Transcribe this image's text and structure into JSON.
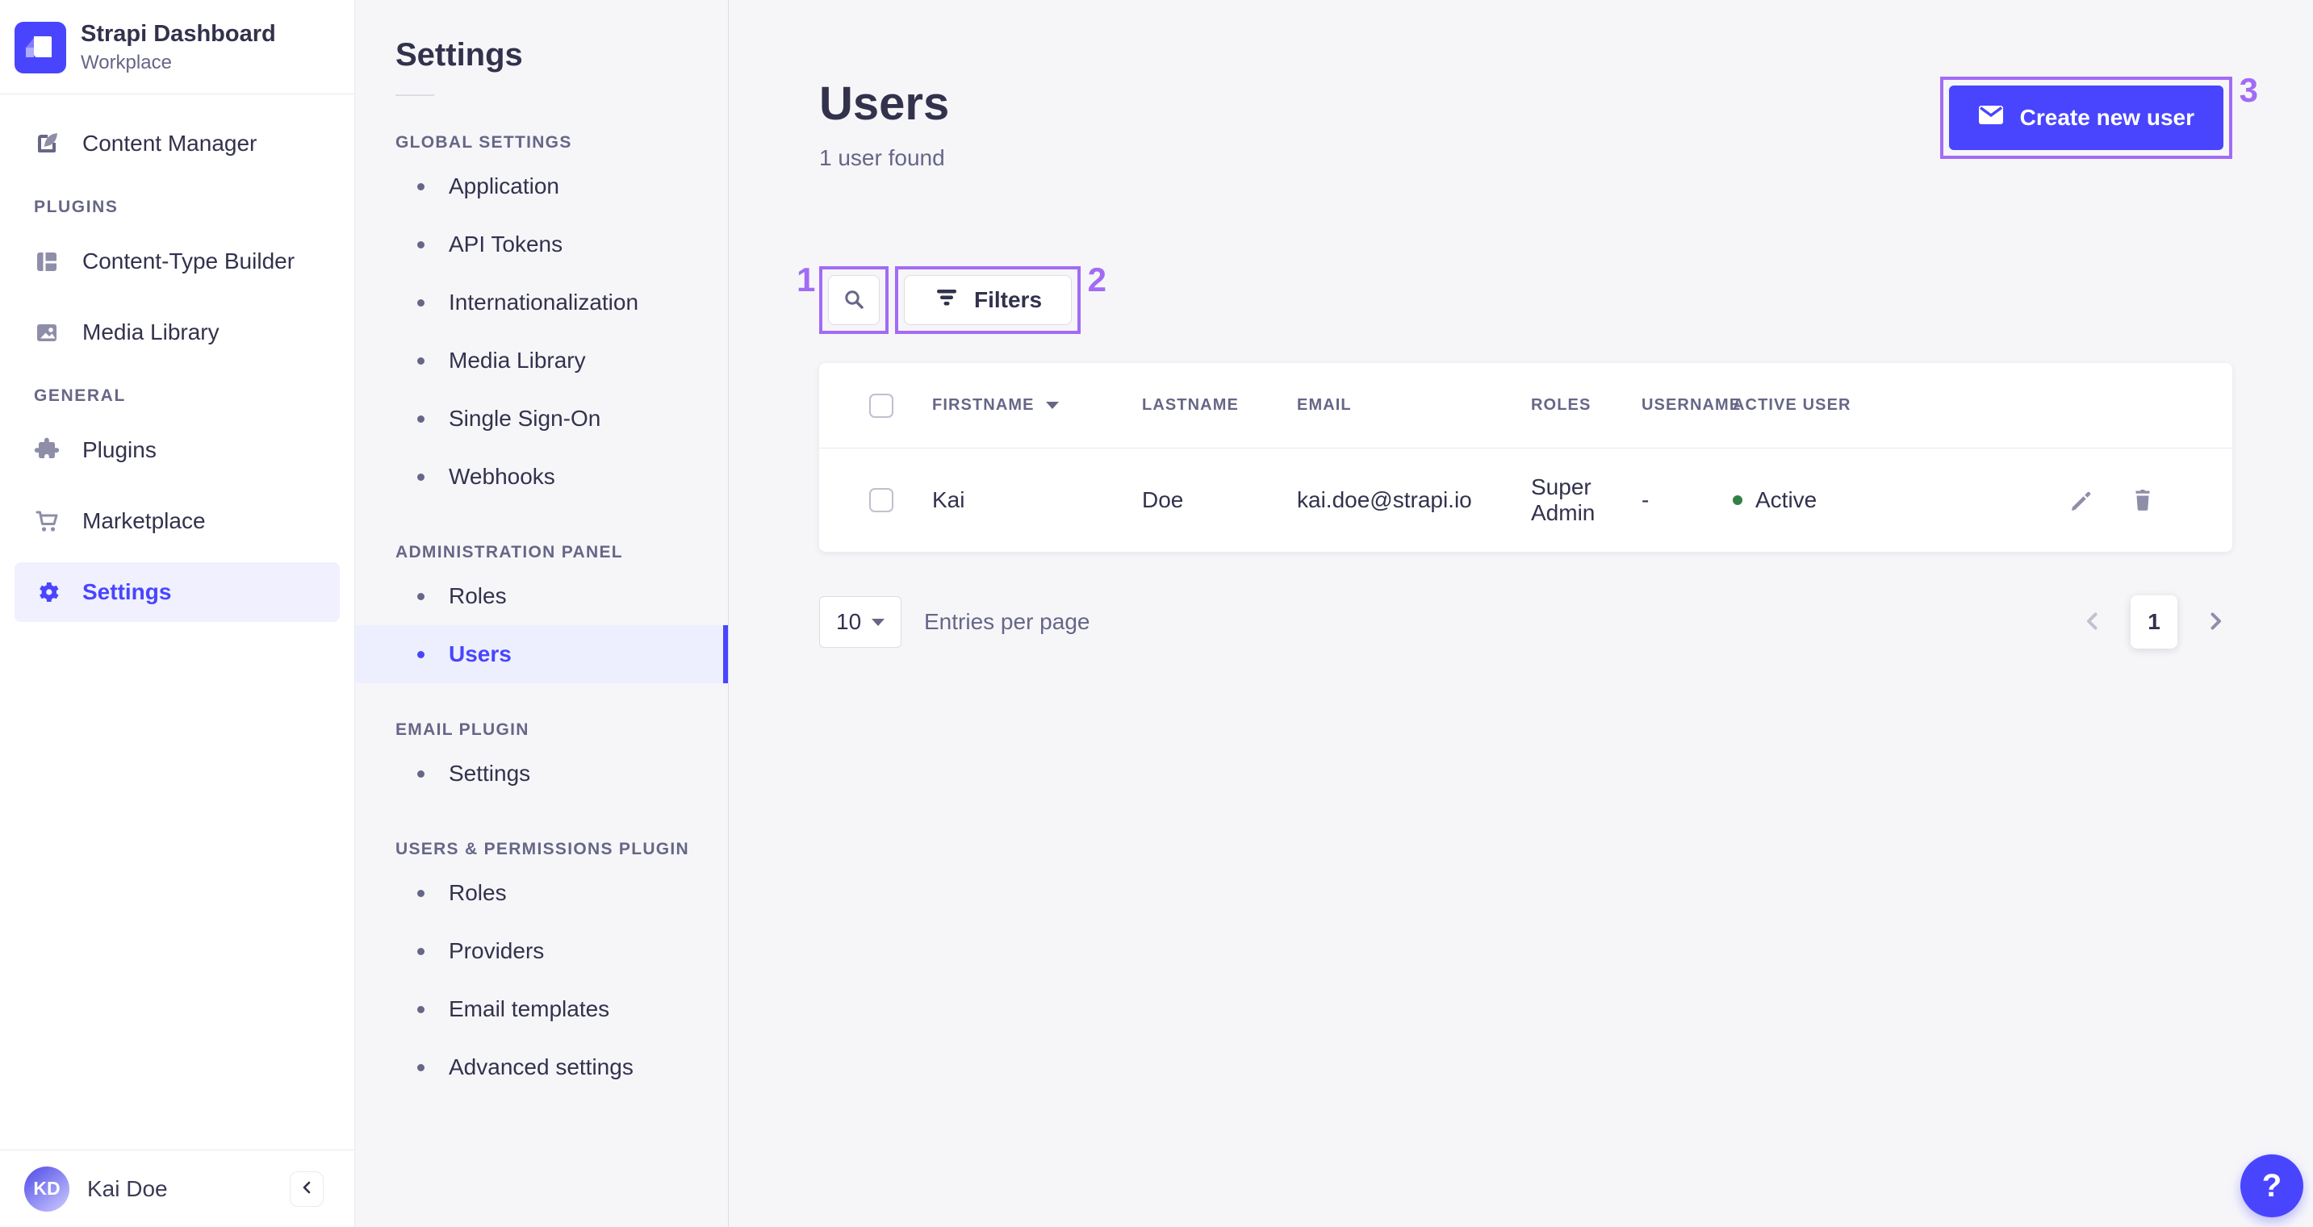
{
  "colors": {
    "accent": "#4945ff",
    "accent_light_bg": "#f0f0ff",
    "annotation_purple": "#a26bf5",
    "success_green": "#328048",
    "text_dark": "#32324d",
    "text_gray": "#666687"
  },
  "sidebar": {
    "brand": {
      "title": "Strapi Dashboard",
      "subtitle": "Workplace"
    },
    "section_labels": [
      "PLUGINS",
      "GENERAL"
    ],
    "items": [
      {
        "label": "Content Manager",
        "icon": "pen-square-icon"
      },
      {
        "label": "Content-Type Builder",
        "icon": "layout-icon"
      },
      {
        "label": "Media Library",
        "icon": "image-icon"
      },
      {
        "label": "Plugins",
        "icon": "puzzle-icon"
      },
      {
        "label": "Marketplace",
        "icon": "cart-icon"
      },
      {
        "label": "Settings",
        "icon": "gear-icon",
        "active": true
      }
    ],
    "footer": {
      "avatar_initials": "KD",
      "user_name": "Kai Doe"
    }
  },
  "subnav": {
    "title": "Settings",
    "sections": [
      {
        "label": "GLOBAL SETTINGS",
        "items": [
          "Application",
          "API Tokens",
          "Internationalization",
          "Media Library",
          "Single Sign-On",
          "Webhooks"
        ]
      },
      {
        "label": "ADMINISTRATION PANEL",
        "items": [
          "Roles",
          "Users"
        ]
      },
      {
        "label": "EMAIL PLUGIN",
        "items": [
          "Settings"
        ]
      },
      {
        "label": "USERS & PERMISSIONS PLUGIN",
        "items": [
          "Roles",
          "Providers",
          "Email templates",
          "Advanced settings"
        ]
      }
    ],
    "active_item": "Users"
  },
  "main": {
    "title": "Users",
    "subtitle": "1 user found",
    "create_button_label": "Create new user",
    "filters_button_label": "Filters",
    "annotations": {
      "search": "1",
      "filters": "2",
      "create": "3"
    },
    "table": {
      "columns": [
        "FIRSTNAME",
        "LASTNAME",
        "EMAIL",
        "ROLES",
        "USERNAME",
        "ACTIVE USER"
      ],
      "rows": [
        {
          "firstname": "Kai",
          "lastname": "Doe",
          "email": "kai.doe@strapi.io",
          "roles": "Super Admin",
          "username": "-",
          "active_status": "Active"
        }
      ]
    },
    "pagination": {
      "page_size": "10",
      "entries_label": "Entries per page",
      "current_page": "1"
    }
  },
  "help_button_label": "?"
}
